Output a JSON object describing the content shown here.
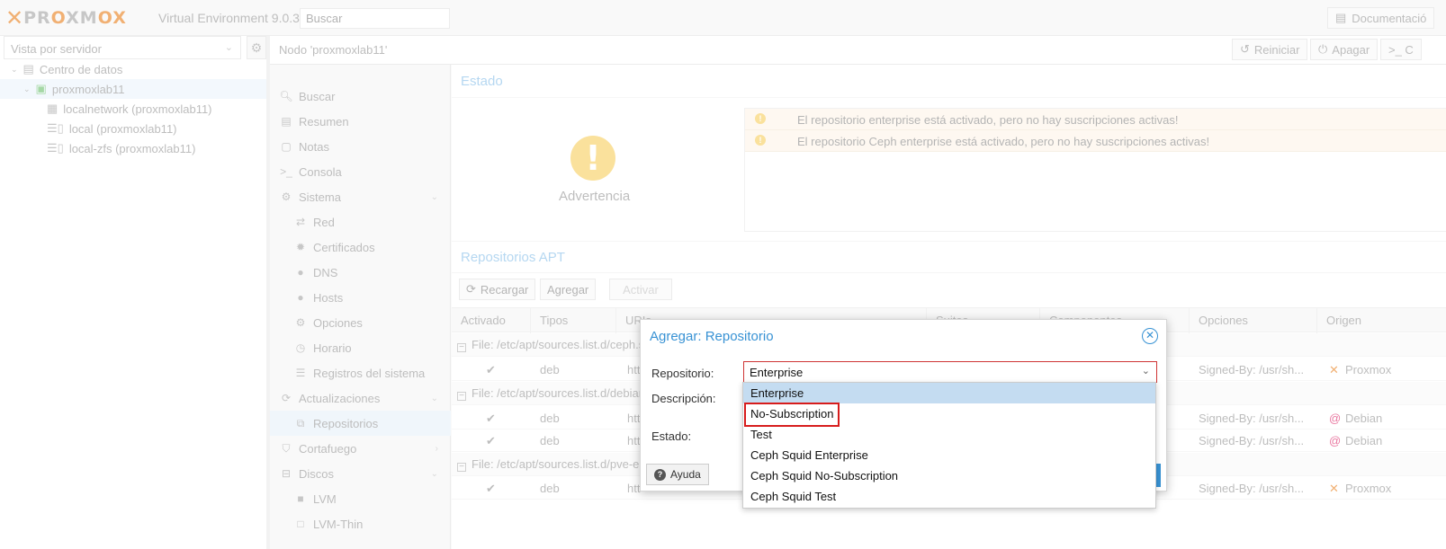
{
  "topbar": {
    "logo_text": "PROXMOX",
    "product": "Virtual Environment 9.0.3",
    "search_placeholder": "Buscar",
    "doc_label": "Documentació"
  },
  "tree": {
    "view_selector": "Vista por servidor",
    "items": [
      {
        "label": "Centro de datos"
      },
      {
        "label": "proxmoxlab11"
      },
      {
        "label": "localnetwork (proxmoxlab11)"
      },
      {
        "label": "local (proxmoxlab11)"
      },
      {
        "label": "local-zfs (proxmoxlab11)"
      }
    ]
  },
  "node_header": {
    "title": "Nodo 'proxmoxlab11'",
    "restart_label": "Reiniciar",
    "shutdown_label": "Apagar",
    "console_label": ">_ C"
  },
  "nav": {
    "items": [
      {
        "label": "Buscar"
      },
      {
        "label": "Resumen"
      },
      {
        "label": "Notas"
      },
      {
        "label": "Consola"
      },
      {
        "label": "Sistema"
      },
      {
        "label": "Red"
      },
      {
        "label": "Certificados"
      },
      {
        "label": "DNS"
      },
      {
        "label": "Hosts"
      },
      {
        "label": "Opciones"
      },
      {
        "label": "Horario"
      },
      {
        "label": "Registros del sistema"
      },
      {
        "label": "Actualizaciones"
      },
      {
        "label": "Repositorios"
      },
      {
        "label": "Cortafuego"
      },
      {
        "label": "Discos"
      },
      {
        "label": "LVM"
      },
      {
        "label": "LVM-Thin"
      }
    ]
  },
  "status": {
    "title": "Estado",
    "warning_label": "Advertencia",
    "messages": [
      "El repositorio enterprise está activado, pero no hay suscripciones activas!",
      "El repositorio Ceph enterprise está activado, pero no hay suscripciones activas!"
    ]
  },
  "apt": {
    "title": "Repositorios APT",
    "reload_label": "Recargar",
    "add_label": "Agregar",
    "enable_label": "Activar",
    "columns": [
      "Activado",
      "Tipos",
      "URIs",
      "Suites",
      "Componentes",
      "Opciones",
      "Origen"
    ],
    "groups": [
      {
        "file": "File: /etc/apt/sources.list.d/ceph.s",
        "rows": [
          {
            "type": "deb",
            "uri": "htt",
            "options": "Signed-By: /usr/sh...",
            "origin": "Proxmox"
          }
        ]
      },
      {
        "file": "File: /etc/apt/sources.list.d/debian",
        "rows": [
          {
            "type": "deb",
            "uri": "htt",
            "options": "Signed-By: /usr/sh...",
            "origin": "Debian"
          },
          {
            "type": "deb",
            "uri": "htt",
            "options": "Signed-By: /usr/sh...",
            "origin": "Debian"
          }
        ]
      },
      {
        "file": "File: /etc/apt/sources.list.d/pve-en",
        "rows": [
          {
            "type": "deb",
            "uri": "htt",
            "options": "Signed-By: /usr/sh...",
            "origin": "Proxmox"
          }
        ]
      }
    ]
  },
  "dialog": {
    "title": "Agregar: Repositorio",
    "repo_label": "Repositorio:",
    "repo_value": "Enterprise",
    "desc_label": "Descripción:",
    "state_label": "Estado:",
    "help_label": "Ayuda",
    "options": [
      "Enterprise",
      "No-Subscription",
      "Test",
      "Ceph Squid Enterprise",
      "Ceph Squid No-Subscription",
      "Ceph Squid Test"
    ],
    "highlighted_option": "Enterprise",
    "annotated_option": "No-Subscription"
  },
  "colors": {
    "accent": "#3892d4",
    "logo_orange": "#e57000",
    "warning": "#f6c84c",
    "annotation_red": "#d71c1c"
  }
}
